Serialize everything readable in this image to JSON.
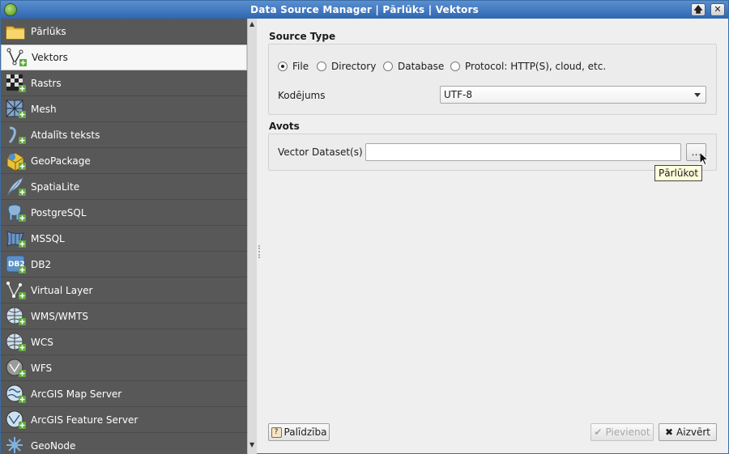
{
  "window": {
    "title": "Data Source Manager | Pārlūks | Vektors",
    "maximize_glyph": "🡅",
    "close_glyph": "✕"
  },
  "sidebar": {
    "items": [
      {
        "label": "Pārlūks",
        "icon": "folder-icon"
      },
      {
        "label": "Vektors",
        "icon": "vector-icon",
        "selected": true
      },
      {
        "label": "Rastrs",
        "icon": "raster-icon"
      },
      {
        "label": "Mesh",
        "icon": "mesh-icon"
      },
      {
        "label": "Atdalīts teksts",
        "icon": "delimited-text-icon"
      },
      {
        "label": "GeoPackage",
        "icon": "geopackage-icon"
      },
      {
        "label": "SpatiaLite",
        "icon": "spatialite-icon"
      },
      {
        "label": "PostgreSQL",
        "icon": "postgresql-icon"
      },
      {
        "label": "MSSQL",
        "icon": "mssql-icon"
      },
      {
        "label": "DB2",
        "icon": "db2-icon"
      },
      {
        "label": "Virtual Layer",
        "icon": "virtual-layer-icon"
      },
      {
        "label": "WMS/WMTS",
        "icon": "wms-icon"
      },
      {
        "label": "WCS",
        "icon": "wcs-icon"
      },
      {
        "label": "WFS",
        "icon": "wfs-icon"
      },
      {
        "label": "ArcGIS Map Server",
        "icon": "arcgis-map-icon"
      },
      {
        "label": "ArcGIS Feature Server",
        "icon": "arcgis-feature-icon"
      },
      {
        "label": "GeoNode",
        "icon": "geonode-icon"
      }
    ],
    "db2_text": "DB2"
  },
  "source_type": {
    "title": "Source Type",
    "options": [
      {
        "label": "File",
        "checked": true
      },
      {
        "label": "Directory",
        "checked": false
      },
      {
        "label": "Database",
        "checked": false
      },
      {
        "label": "Protocol: HTTP(S), cloud, etc.",
        "checked": false
      }
    ],
    "encoding_label": "Kodējums",
    "encoding_value": "UTF-8"
  },
  "avots": {
    "title": "Avots",
    "dataset_label": "Vector Dataset(s)",
    "dataset_value": "",
    "browse_label": "…",
    "tooltip": "Pārlūkot"
  },
  "footer": {
    "help_label": "Palīdzība",
    "add_label": "Pievienot",
    "close_label": "Aizvērt"
  },
  "colors": {
    "sidebar_bg": "#585858",
    "titlebar": "#2f66b0"
  }
}
